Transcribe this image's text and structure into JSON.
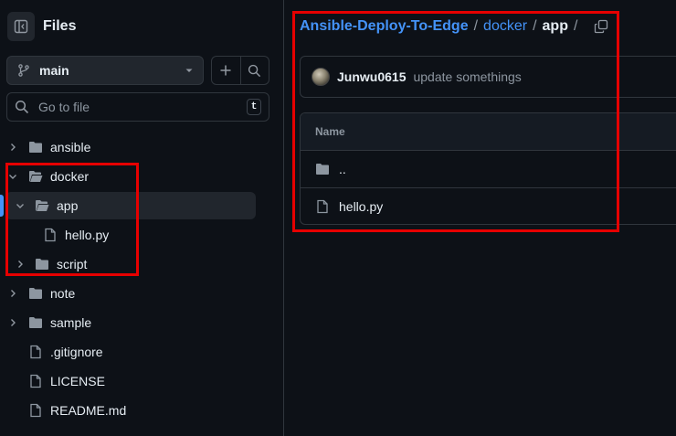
{
  "sidebar": {
    "title": "Files",
    "branch": "main",
    "search_placeholder": "Go to file",
    "search_shortcut": "t",
    "tree": [
      {
        "label": "ansible",
        "type": "folder"
      },
      {
        "label": "docker",
        "type": "folder-open"
      },
      {
        "label": "app",
        "type": "folder-open"
      },
      {
        "label": "hello.py",
        "type": "file"
      },
      {
        "label": "script",
        "type": "folder"
      },
      {
        "label": "note",
        "type": "folder"
      },
      {
        "label": "sample",
        "type": "folder"
      },
      {
        "label": ".gitignore",
        "type": "file"
      },
      {
        "label": "LICENSE",
        "type": "file"
      },
      {
        "label": "README.md",
        "type": "file"
      }
    ]
  },
  "breadcrumb": {
    "repo": "Ansible-Deploy-To-Edge",
    "sep": "/",
    "folder": "docker",
    "current": "app"
  },
  "commit": {
    "user": "Junwu0615",
    "message": "update somethings"
  },
  "table": {
    "header_name": "Name",
    "rows": [
      {
        "name": "..",
        "type": "folder"
      },
      {
        "name": "hello.py",
        "type": "file"
      }
    ]
  },
  "colors": {
    "background": "#0d1117",
    "accent": "#4493f8",
    "highlight_box": "#e60000"
  }
}
